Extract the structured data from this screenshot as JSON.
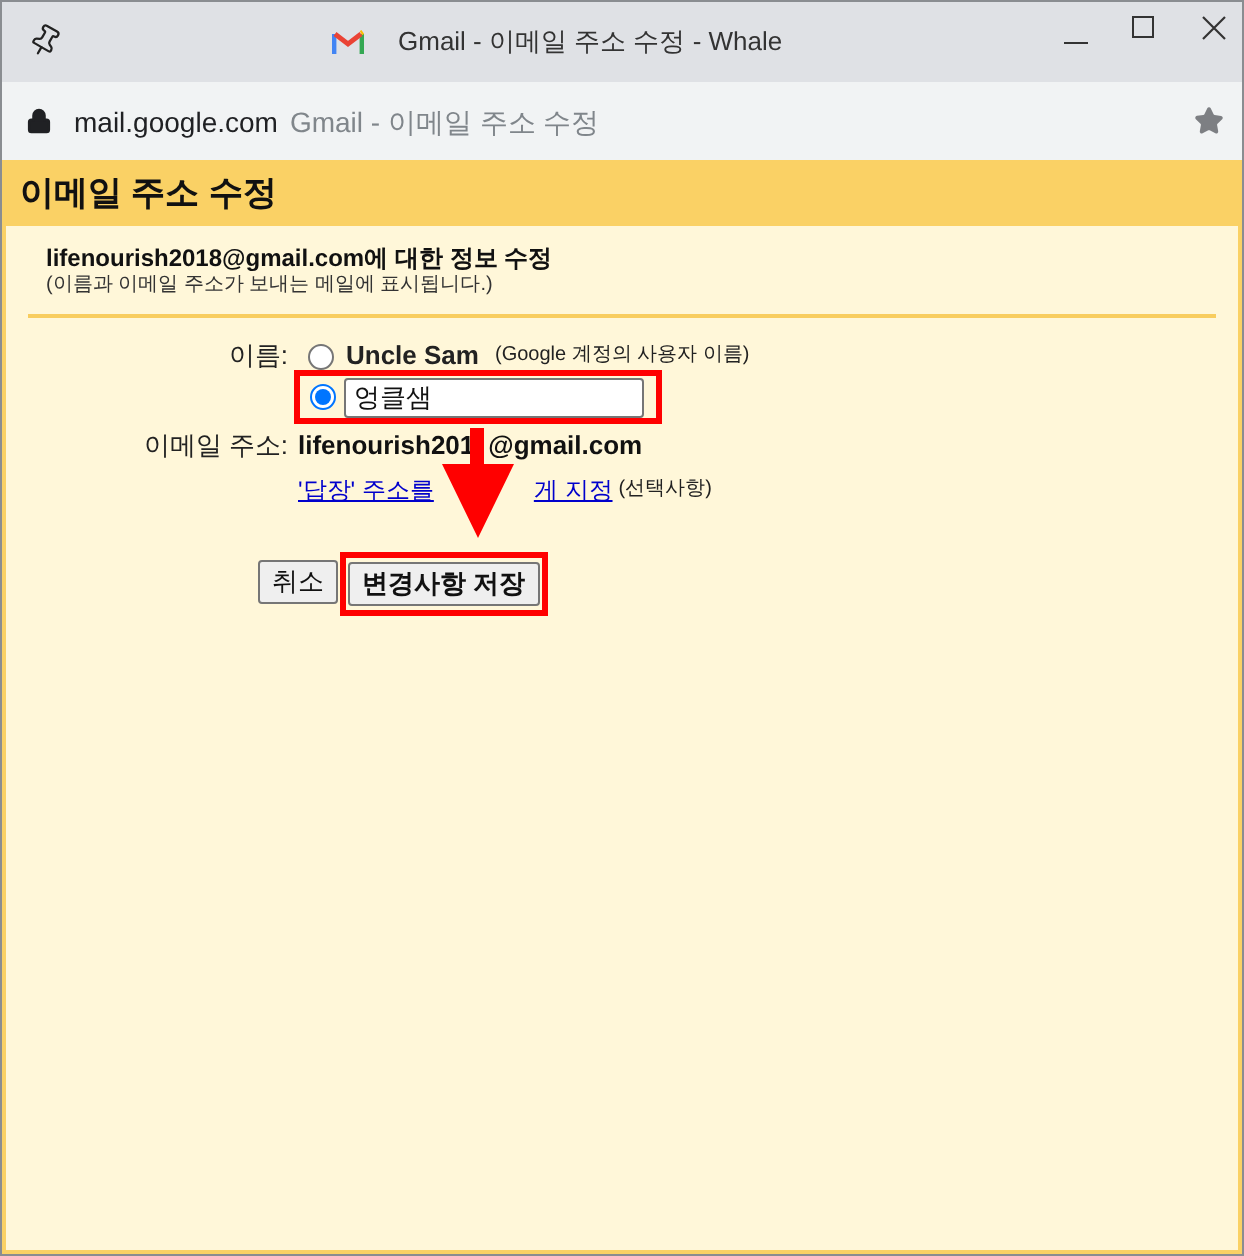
{
  "window": {
    "title": "Gmail - 이메일 주소 수정 - Whale"
  },
  "address_bar": {
    "domain": "mail.google.com",
    "page_title": "Gmail - 이메일 주소 수정"
  },
  "page": {
    "title": "이메일 주소 수정",
    "heading": "lifenourish2018@gmail.com에 대한 정보 수정",
    "note": "(이름과 이메일 주소가 보내는 메일에 표시됩니다.)"
  },
  "form": {
    "name_label": "이름:",
    "name_options": [
      {
        "kind": "preset",
        "label": "Uncle Sam",
        "hint": "(Google 계정의 사용자 이름)",
        "selected": false,
        "highlighted": false
      },
      {
        "kind": "custom",
        "value": "엉클샘",
        "selected": true,
        "highlighted": true
      }
    ],
    "email_label": "이메일 주소:",
    "email_parts": [
      "lifenourish201",
      "@gmail.com"
    ],
    "reply_link_parts": [
      "'답장' 주소를",
      "게 지정"
    ],
    "reply_hint": "(선택사항)"
  },
  "buttons": [
    {
      "kind": "cancel",
      "label": "취소",
      "highlighted": false
    },
    {
      "kind": "save",
      "label": "변경사항 저장",
      "highlighted": true
    }
  ]
}
